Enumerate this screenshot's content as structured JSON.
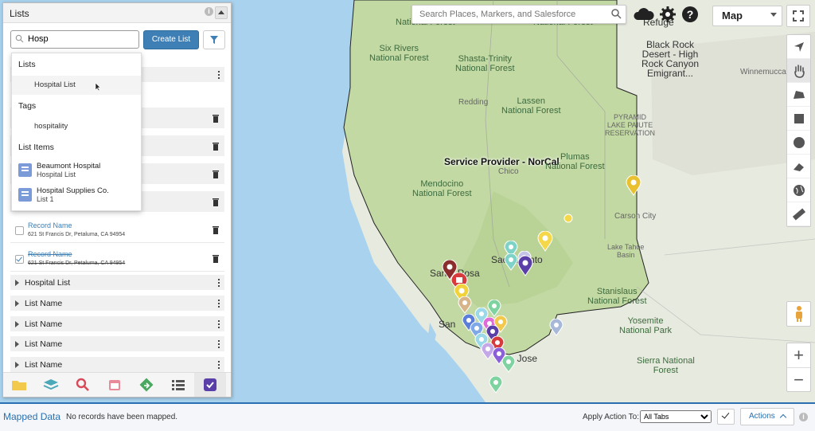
{
  "panel": {
    "title": "Lists",
    "search_value": "Hosp",
    "create_list_label": "Create List",
    "dropdown": {
      "lists_heading": "Lists",
      "lists_option": "Hospital List",
      "tags_heading": "Tags",
      "tags_option": "hospitality",
      "items_heading": "List Items",
      "items": [
        {
          "name": "Beaumont Hospital",
          "list": "Hospital List"
        },
        {
          "name": "Hospital Supplies Co.",
          "list": "List 1"
        }
      ]
    },
    "records": [
      {
        "name": "Record Name",
        "address": "621 St Francis Dr, Petaluma, CA 94954",
        "checked": false
      },
      {
        "name": "Record Name",
        "address": "621 St Francis Dr, Petaluma, CA 94954",
        "checked": true
      }
    ],
    "groups": [
      "Hospital List",
      "List Name",
      "List Name",
      "List Name",
      "List Name"
    ],
    "footer_icons": [
      "folder-icon",
      "layers-icon",
      "search-icon",
      "calendar-icon",
      "route-icon",
      "list-icon",
      "checkbox-icon"
    ]
  },
  "map": {
    "search_placeholder": "Search Places, Markers, and Salesforce",
    "type": "Map",
    "labels": {
      "six_rivers": "Six Rivers\nNational Forest",
      "shasta_trinity": "Shasta-Trinity\nNational Forest",
      "redding": "Redding",
      "lassen": "Lassen\nNational Forest",
      "pyramid": "PYRAMID\nLAKE PAIUTE\nRESERVATION",
      "provider": "Service Provider - NorCal",
      "plumas": "Plumas\nNational Forest",
      "chico": "Chico",
      "mendocino": "Mendocino\nNational Forest",
      "black_rock": "Black Rock\nDesert - High\nRock Canyon\nEmigrant...",
      "winnemucca": "Winnemucca",
      "carson": "Carson City",
      "tahoe": "Lake Tahoe\nBasin",
      "sacramento": "Sacramento",
      "santa_rosa": "Santa Rosa",
      "stanislaus": "Stanislaus\nNational Forest",
      "yosemite": "Yosemite\nNational Park",
      "sierra": "Sierra National\nForest",
      "sf": "San",
      "san_jose": "San Jose",
      "klamath": "National Forest",
      "klamath2": "National Forest",
      "refuge": "Refuge"
    }
  },
  "bottom": {
    "title": "Mapped Data",
    "no_records": "No records have been mapped.",
    "apply_label": "Apply Action To:",
    "apply_value": "All Tabs",
    "actions_label": "Actions"
  },
  "colors": {
    "accent": "#3e7fb6",
    "land": "#c3d9a4",
    "water": "#a8d2ee"
  }
}
